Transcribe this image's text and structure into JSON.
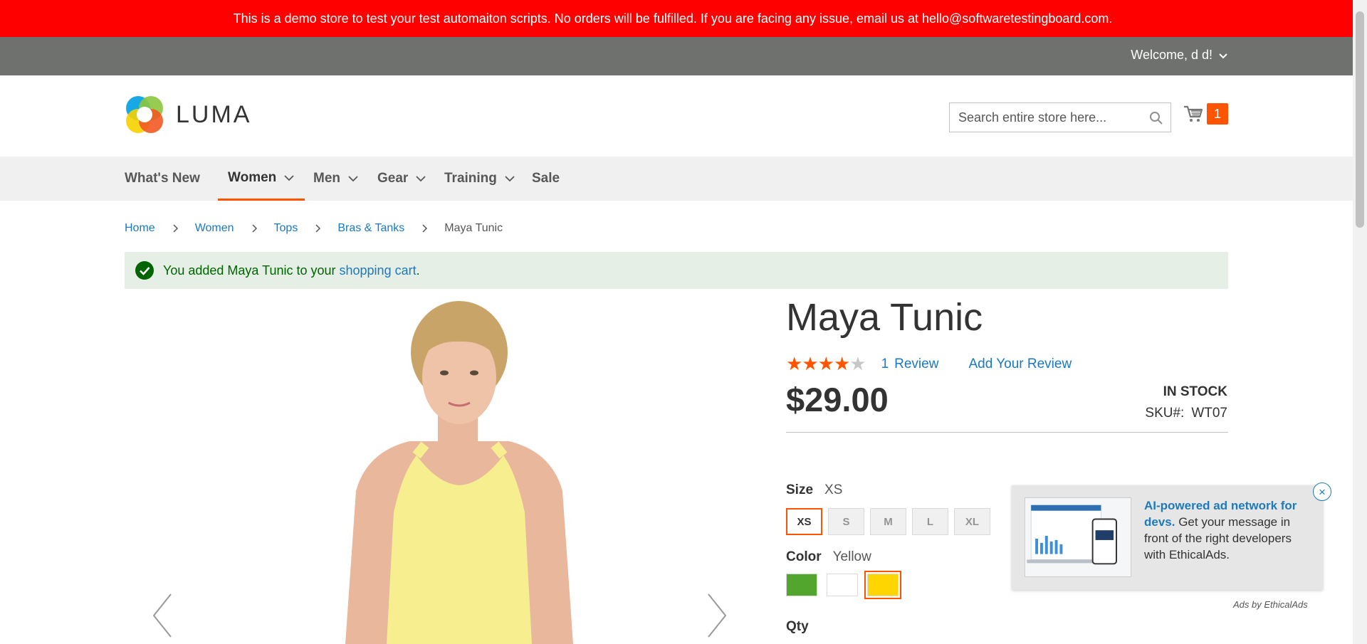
{
  "demo_banner": {
    "text": "This is a demo store to test your test automaiton scripts. No orders will be fulfilled. If you are facing any issue, email us at hello@softwaretestingboard.com."
  },
  "header": {
    "welcome": "Welcome, d d!",
    "logo_text": "LUMA",
    "search_placeholder": "Search entire store here...",
    "cart_count": "1"
  },
  "nav": {
    "items": [
      {
        "label": "What's New",
        "has_submenu": false,
        "active": false
      },
      {
        "label": "Women",
        "has_submenu": true,
        "active": true
      },
      {
        "label": "Men",
        "has_submenu": true,
        "active": false
      },
      {
        "label": "Gear",
        "has_submenu": true,
        "active": false
      },
      {
        "label": "Training",
        "has_submenu": true,
        "active": false
      },
      {
        "label": "Sale",
        "has_submenu": false,
        "active": false
      }
    ]
  },
  "breadcrumbs": [
    "Home",
    "Women",
    "Tops",
    "Bras & Tanks",
    "Maya Tunic"
  ],
  "message": {
    "prefix": "You added Maya Tunic to your",
    "link": "shopping cart",
    "suffix": "."
  },
  "product": {
    "title": "Maya Tunic",
    "rating_stars": 4,
    "rating_max": 5,
    "review_count": "1",
    "review_label": "Review",
    "add_review": "Add Your Review",
    "price": "$29.00",
    "stock": "IN STOCK",
    "sku_label": "SKU#:",
    "sku": "WT07",
    "size_label": "Size",
    "size_selected": "XS",
    "sizes": [
      "XS",
      "S",
      "M",
      "L",
      "XL"
    ],
    "color_label": "Color",
    "color_selected": "Yellow",
    "colors": [
      {
        "name": "Green",
        "hex": "#53a62d"
      },
      {
        "name": "White",
        "hex": "#ffffff"
      },
      {
        "name": "Yellow",
        "hex": "#ffd500"
      }
    ],
    "qty_label": "Qty"
  },
  "ad": {
    "headline": "AI-powered ad network for devs.",
    "body": " Get your message in front of the right developers with EthicalAds.",
    "footer": "Ads by EthicalAds",
    "close": "×"
  },
  "colors": {
    "banner": "#ff0000",
    "accent": "#ff5501",
    "link": "#1979c3"
  }
}
